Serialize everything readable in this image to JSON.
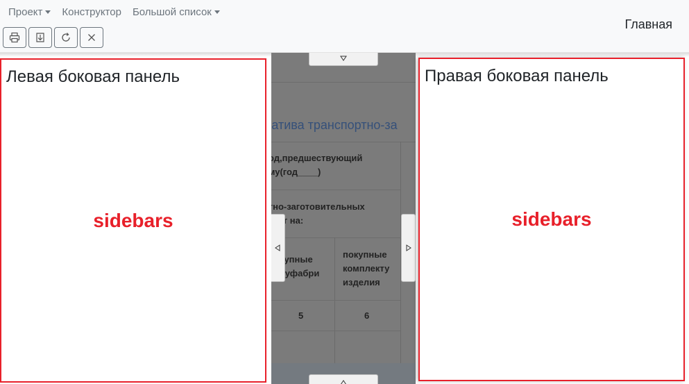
{
  "navbar": {
    "menu": [
      {
        "label": "Проект",
        "dropdown": true
      },
      {
        "label": "Конструктор",
        "dropdown": false
      },
      {
        "label": "Большой список",
        "dropdown": true
      }
    ],
    "toolbar": [
      "print-icon",
      "download-icon",
      "refresh-icon",
      "close-icon"
    ],
    "home_label": "Главная"
  },
  "center": {
    "doc_title": "матива транспортно-за",
    "table": {
      "header_1": [
        "иод,предшествующий",
        "ому(год____)"
      ],
      "header_2": [
        "ртно-заготовительных",
        "атрат на:"
      ],
      "col_5_header": [
        "окупные",
        "олуфабри"
      ],
      "col_6_header": [
        "покупные",
        "комплекту",
        "изделия"
      ],
      "col_numbers": [
        "5",
        "6"
      ]
    }
  },
  "sidebar_left": {
    "title": "Левая боковая панель",
    "tag": "sidebars"
  },
  "sidebar_right": {
    "title": "Правая боковая панель",
    "tag": "sidebars"
  },
  "colors": {
    "accent": "#e8202a",
    "navbar_bg": "#f8f9fa",
    "overlay": "#7b7b7b"
  }
}
